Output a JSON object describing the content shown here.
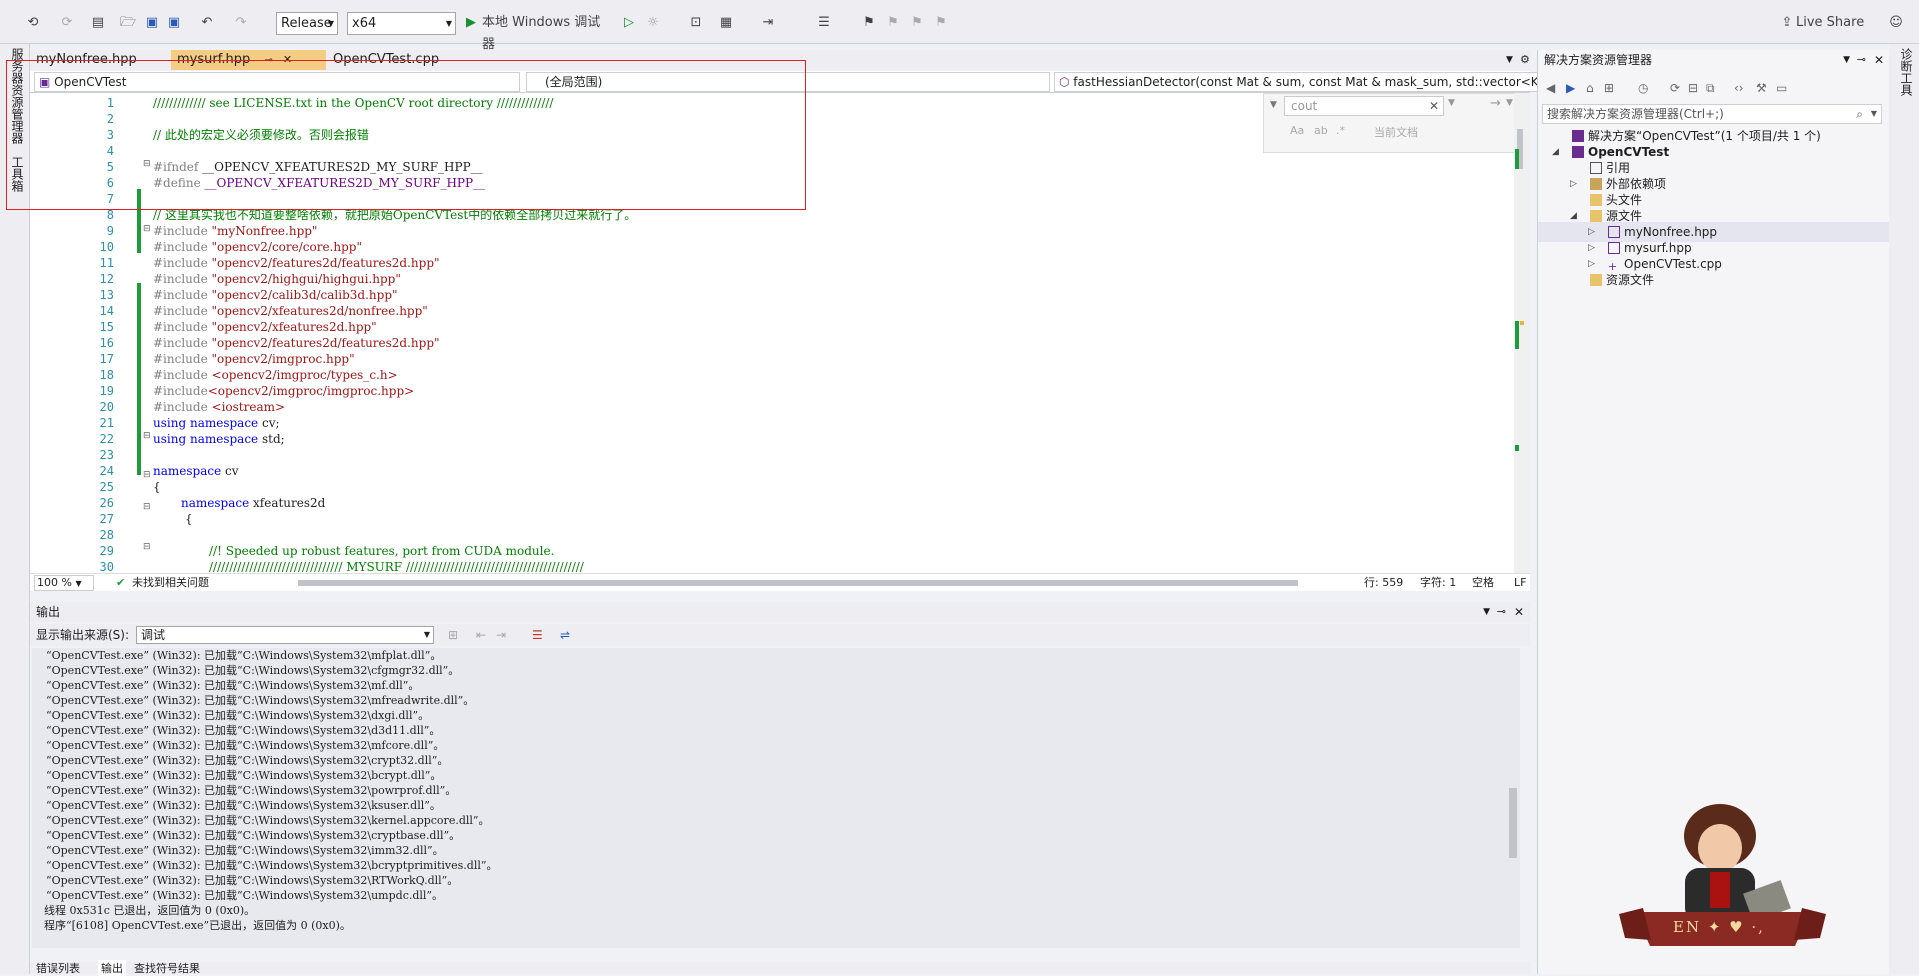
{
  "toolbar": {
    "config": "Release",
    "platform": "x64",
    "run_label": "本地 Windows 调试器",
    "live_share": "Live Share"
  },
  "left_tabs": {
    "server_explorer": "服务器资源管理器",
    "toolbox": "工具箱"
  },
  "right_tabs": {
    "diagnostics": "诊断工具"
  },
  "doc_tabs": [
    {
      "label": "myNonfree.hpp"
    },
    {
      "label": "mysurf.hpp"
    },
    {
      "label": "OpenCVTest.cpp"
    }
  ],
  "nav": {
    "project": "OpenCVTest",
    "scope": "(全局范围)",
    "member": "fastHessianDetector(const Mat & sum, const Mat & mask_sum, std::vector<Key"
  },
  "find": {
    "query": "cout",
    "scope": "当前文档"
  },
  "line_numbers": [
    "1",
    "2",
    "3",
    "4",
    "5",
    "6",
    "7",
    "8",
    "9",
    "10",
    "11",
    "12",
    "13",
    "14",
    "15",
    "16",
    "17",
    "18",
    "19",
    "20",
    "21",
    "22",
    "23",
    "24",
    "25",
    "26",
    "27",
    "28",
    "29",
    "30"
  ],
  "code": {
    "l1": "///////////// see LICENSE.txt in the OpenCV root directory //////////////",
    "l3": "// 此处的宏定义必须要修改。否则会报错",
    "l5a": "#ifndef ",
    "l5b": "__OPENCV_XFEATURES2D_MY_SURF_HPP__",
    "l6a": "#define ",
    "l6b": "__OPENCV_XFEATURES2D_MY_SURF_HPP__",
    "l8": "// 这里其实我也不知道要整啥依赖，就把原始OpenCVTest中的依赖全部拷贝过来就行了。",
    "inc_kw": "#include ",
    "l9": "\"myNonfree.hpp\"",
    "l10": "\"opencv2/core/core.hpp\"",
    "l11": "\"opencv2/features2d/features2d.hpp\"",
    "l12": "\"opencv2/highgui/highgui.hpp\"",
    "l13": "\"opencv2/calib3d/calib3d.hpp\"",
    "l14": "\"opencv2/xfeatures2d/nonfree.hpp\"",
    "l15": "\"opencv2/xfeatures2d.hpp\"",
    "l16": "\"opencv2/features2d/features2d.hpp\"",
    "l17": "\"opencv2/imgproc.hpp\"",
    "l18": "<opencv2/imgproc/types_c.h>",
    "l19a": "#include",
    "l19": "<opencv2/imgproc/imgproc.hpp>",
    "l20": "<iostream>",
    "using_kw": "using",
    "namespace_kw": "namespace",
    "l21": " cv;",
    "l22": " std;",
    "l24": " cv",
    "l25": "{",
    "l26": " xfeatures2d",
    "l27": "{",
    "l29": "//! Speeded up robust features, port from CUDA module.",
    "l30": "///////////////////////////////// MYSURF ////////////////////////////////////////////"
  },
  "status": {
    "zoom": "100 %",
    "issues": "未找到相关问题",
    "line": "行: 559",
    "char": "字符: 1",
    "whitespace": "空格",
    "eol": "LF"
  },
  "output": {
    "title": "输出",
    "source_label": "显示输出来源(S):",
    "source_value": "调试",
    "lines": [
      "“OpenCVTest.exe” (Win32): 已加载“C:\\Windows\\System32\\mfplat.dll”。",
      "“OpenCVTest.exe” (Win32): 已加载“C:\\Windows\\System32\\cfgmgr32.dll”。",
      "“OpenCVTest.exe” (Win32): 已加载“C:\\Windows\\System32\\mf.dll”。",
      "“OpenCVTest.exe” (Win32): 已加载“C:\\Windows\\System32\\mfreadwrite.dll”。",
      "“OpenCVTest.exe” (Win32): 已加载“C:\\Windows\\System32\\dxgi.dll”。",
      "“OpenCVTest.exe” (Win32): 已加载“C:\\Windows\\System32\\d3d11.dll”。",
      "“OpenCVTest.exe” (Win32): 已加载“C:\\Windows\\System32\\mfcore.dll”。",
      "“OpenCVTest.exe” (Win32): 已加载“C:\\Windows\\System32\\crypt32.dll”。",
      "“OpenCVTest.exe” (Win32): 已加载“C:\\Windows\\System32\\bcrypt.dll”。",
      "“OpenCVTest.exe” (Win32): 已加载“C:\\Windows\\System32\\powrprof.dll”。",
      "“OpenCVTest.exe” (Win32): 已加载“C:\\Windows\\System32\\ksuser.dll”。",
      "“OpenCVTest.exe” (Win32): 已加载“C:\\Windows\\System32\\kernel.appcore.dll”。",
      "“OpenCVTest.exe” (Win32): 已加载“C:\\Windows\\System32\\cryptbase.dll”。",
      "“OpenCVTest.exe” (Win32): 已加载“C:\\Windows\\System32\\imm32.dll”。",
      "“OpenCVTest.exe” (Win32): 已加载“C:\\Windows\\System32\\bcryptprimitives.dll”。",
      "“OpenCVTest.exe” (Win32): 已加载“C:\\Windows\\System32\\RTWorkQ.dll”。",
      "“OpenCVTest.exe” (Win32): 已加载“C:\\Windows\\System32\\umpdc.dll”。",
      "线程 0x531c 已退出，返回值为 0 (0x0)。",
      "程序“[6108] OpenCVTest.exe”已退出，返回值为 0 (0x0)。"
    ]
  },
  "bottom_tabs": [
    "错误列表",
    "输出",
    "查找符号结果"
  ],
  "solution_explorer": {
    "title": "解决方案资源管理器",
    "search_placeholder": "搜索解决方案资源管理器(Ctrl+;)",
    "solution": "解决方案“OpenCVTest”(1 个项目/共 1 个)",
    "project": "OpenCVTest",
    "references": "引用",
    "external_deps": "外部依赖项",
    "headers": "头文件",
    "sources": "源文件",
    "file1": "myNonfree.hpp",
    "file2": "mysurf.hpp",
    "file3": "OpenCVTest.cpp",
    "resources": "资源文件"
  },
  "mascot_badge": "EN ✦ ♥ ·,"
}
